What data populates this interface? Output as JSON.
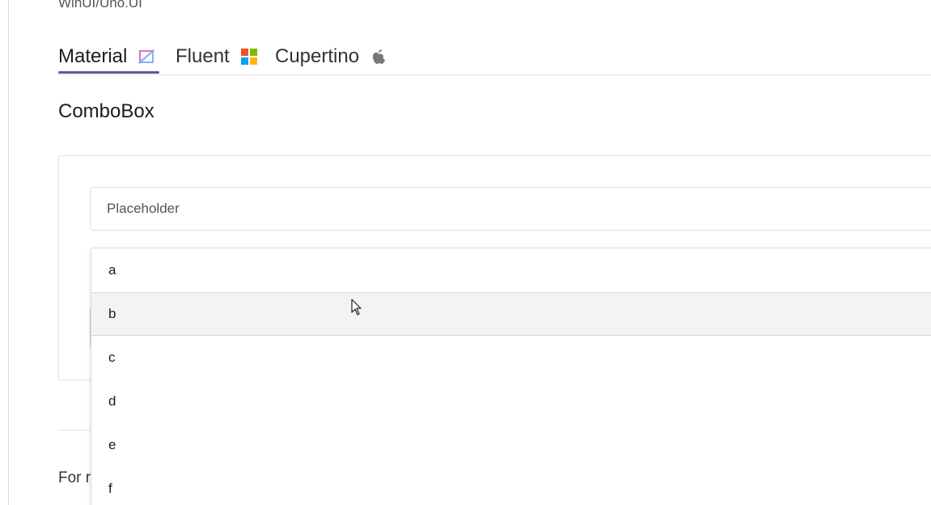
{
  "breadcrumb": "WinUI/Uno.UI",
  "tabs": [
    {
      "label": "Material",
      "icon": "material-logo-icon",
      "active": true
    },
    {
      "label": "Fluent",
      "icon": "windows-logo-icon",
      "active": false
    },
    {
      "label": "Cupertino",
      "icon": "apple-logo-icon",
      "active": false
    }
  ],
  "colors": {
    "accent": "#6750a4",
    "hover_row": "#f3f3f3",
    "border": "#e0e0e0"
  },
  "section_title": "ComboBox",
  "placeholder_combo": {
    "placeholder": "Placeholder"
  },
  "dropdown": {
    "hovered_index": 1,
    "options": [
      "a",
      "b",
      "c",
      "d",
      "e",
      "f"
    ]
  },
  "footer_text": "For r"
}
